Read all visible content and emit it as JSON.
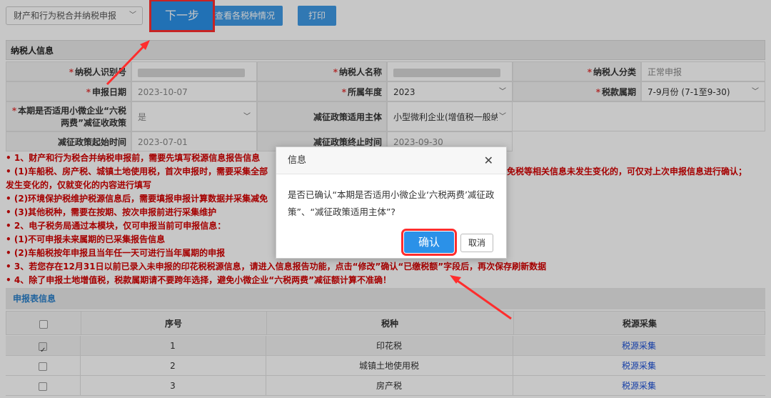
{
  "toolbar": {
    "declaration_type": "财产和行为税合并纳税申报",
    "next_label": "下一步",
    "view_tax_label": "查看各税种情况",
    "print_label": "打印"
  },
  "taxpayer": {
    "section_title": "纳税人信息",
    "id_label": "纳税人识别号",
    "name_label": "纳税人名称",
    "category_label": "纳税人分类",
    "category_value": "正常申报",
    "date_label": "申报日期",
    "date_value": "2023-10-07",
    "year_label": "所属年度",
    "year_value": "2023",
    "period_label": "税款属期",
    "period_value": "7-9月份 (7-1至9-30)",
    "policy_label": "本期是否适用小微企业“六税两费”减征收政策",
    "policy_value": "是",
    "policy_subject_label": "减征政策适用主体",
    "policy_subject_value": "小型微利企业(增值税一般纳",
    "start_label": "减征政策起始时间",
    "start_value": "2023-07-01",
    "end_label": "减征政策终止时间",
    "end_value": "2023-09-30"
  },
  "notes": [
    "• 1、财产和行为税合并纳税申报前，需要先填写税源信息报告信息",
    "• (1)车船税、房产税、城镇土地使用税，首次申报时，需要采集全部",
    "免税等相关信息未发生变化的，可仅对上次申报信息进行确认；",
    "发生变化的，仅就变化的内容进行填写",
    "• (2)环境保护税维护税源信息后，需要填报申报计算数据并采集减免",
    "• (3)其他税种，需要在按期、按次申报前进行采集维护",
    "• 2、电子税务局通过本模块，仅可申报当前可申报信息：",
    "• (1)不可申报未来属期的已采集报告信息",
    "• (2)车船税按年申报且当年任一天可进行当年属期的申报",
    "• 3、若您存在12月31日以前已录入未申报的印花税税源信息，请进入信息报告功能，点击“修改”确认“已缴税额”字段后，再次保存刷新数据",
    "• 4、除了申报土地增值税，税款属期请不要跨年选择，避免小微企业“六税两费”减征额计算不准确！"
  ],
  "declaration_table": {
    "section_title": "申报表信息",
    "columns": [
      "序号",
      "税种",
      "税源采集"
    ],
    "rows": [
      {
        "checked": true,
        "no": "1",
        "tax": "印花税",
        "action": "税源采集"
      },
      {
        "checked": false,
        "no": "2",
        "tax": "城镇土地使用税",
        "action": "税源采集"
      },
      {
        "checked": false,
        "no": "3",
        "tax": "房产税",
        "action": "税源采集"
      }
    ]
  },
  "dialog": {
    "title": "信息",
    "message": "是否已确认“本期是否适用小微企业‘六税两费’减征政策”、“减征政策适用主体”?",
    "confirm_label": "确认",
    "cancel_label": "取消"
  },
  "colors": {
    "primary_blue": "#2b91e8",
    "highlight_red": "#ff2d2d",
    "notes_red": "#d40000",
    "link_blue": "#1a4fd6"
  }
}
